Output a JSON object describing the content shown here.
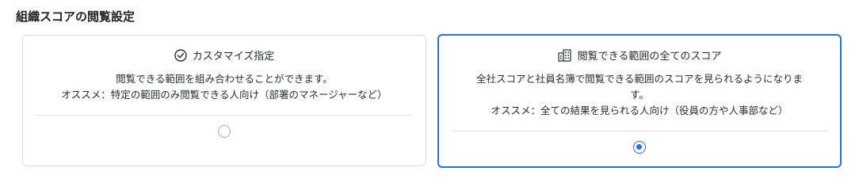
{
  "section": {
    "title": "組織スコアの閲覧設定"
  },
  "options": [
    {
      "title": "カスタマイズ指定",
      "icon": "check-circle-icon",
      "description_lines": [
        "閲覧できる範囲を組み合わせることができます。",
        "オススメ：特定の範囲のみ閲覧できる人向け（部署のマネージャーなど）"
      ],
      "selected": false
    },
    {
      "title": "閲覧できる範囲の全てのスコア",
      "icon": "building-icon",
      "description_lines": [
        "全社スコアと社員名簿で閲覧できる範囲のスコアを見られるようになりま",
        "す。",
        "オススメ：全ての結果を見られる人向け（役員の方や人事部など）"
      ],
      "selected": true
    }
  ],
  "colors": {
    "accent": "#2f6fc5",
    "border": "#d9dce1"
  }
}
